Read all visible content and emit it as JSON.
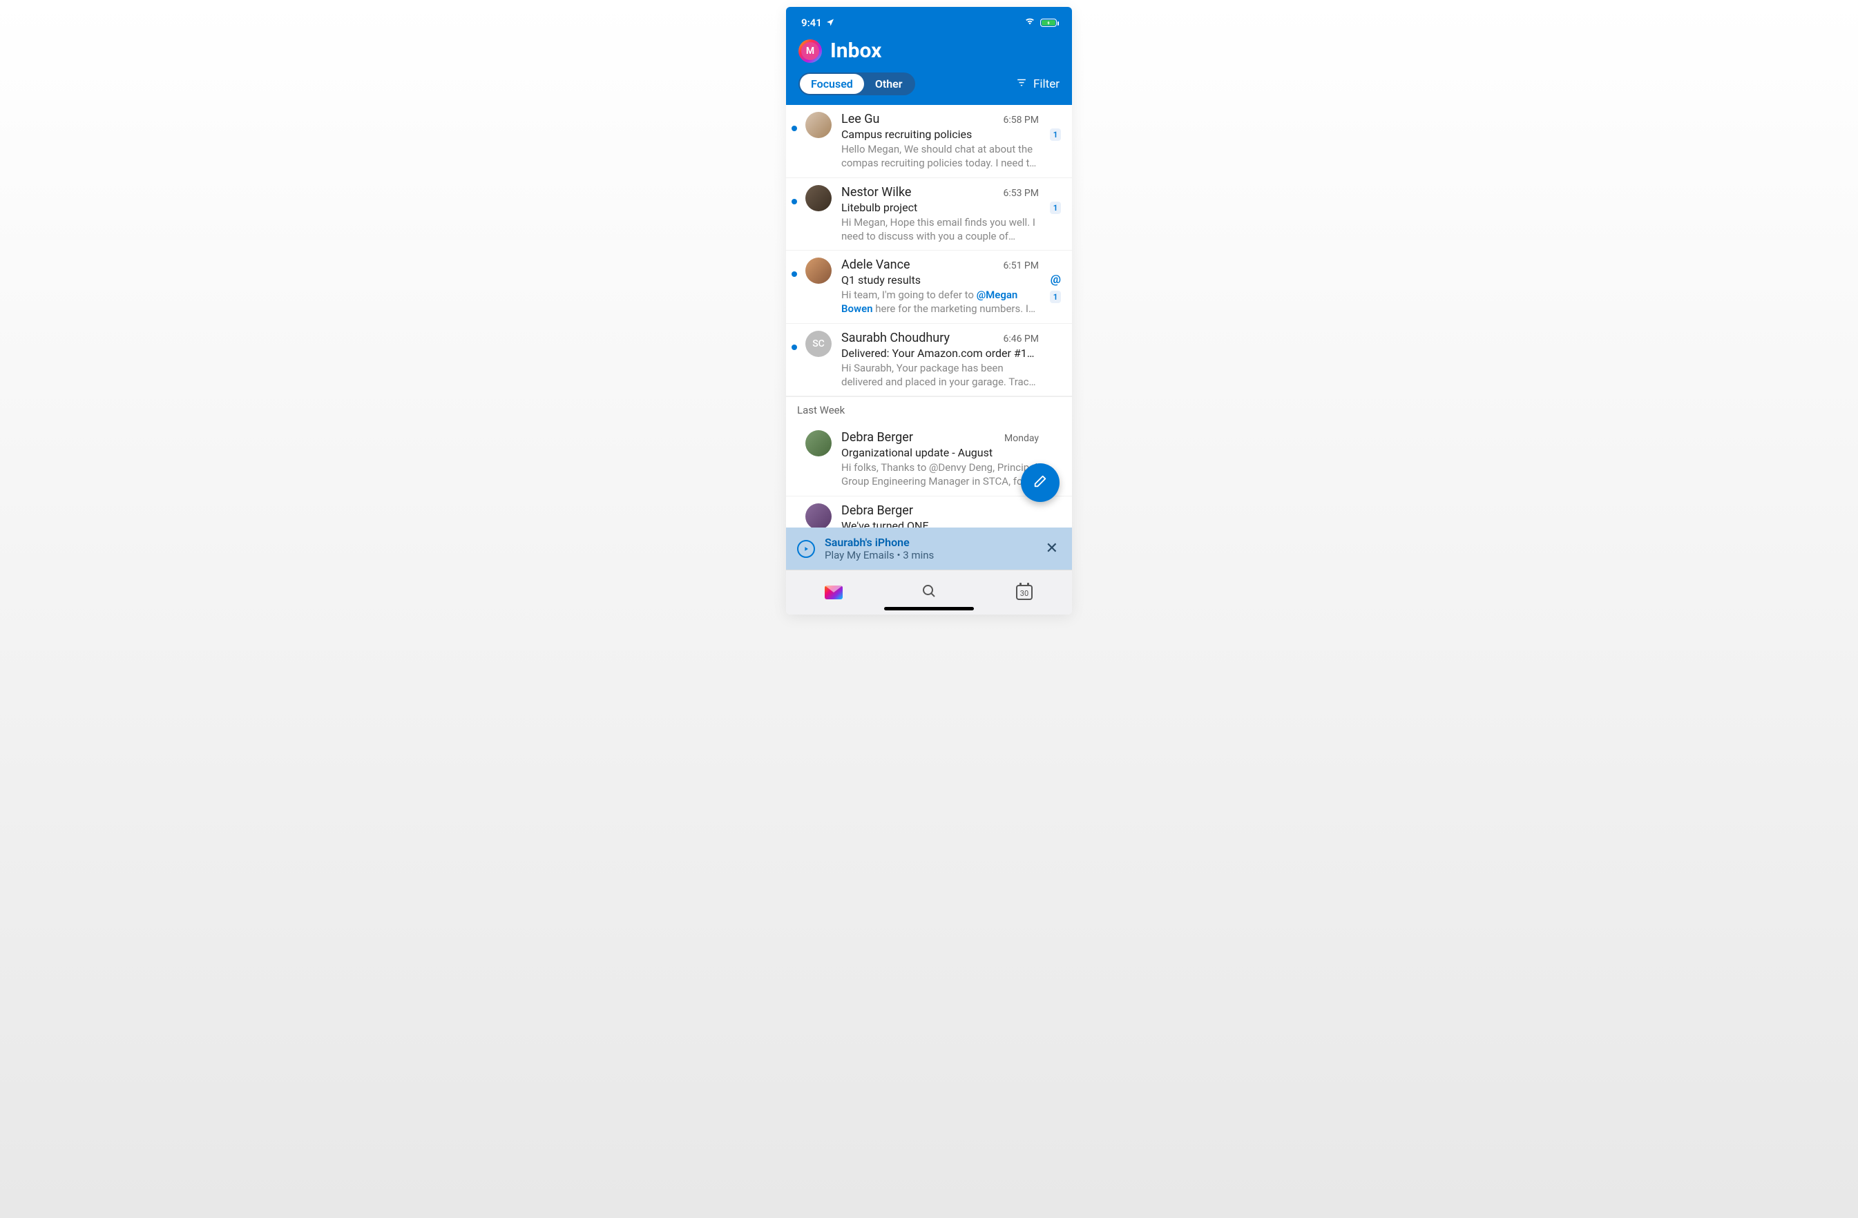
{
  "status": {
    "time": "9:41",
    "battery_pct": 100
  },
  "header": {
    "avatar_initial": "M",
    "title": "Inbox",
    "tab_focused": "Focused",
    "tab_other": "Other",
    "filter_label": "Filter"
  },
  "section_last_week": "Last Week",
  "emails": [
    {
      "sender": "Lee Gu",
      "time": "6:58 PM",
      "subject": "Campus recruiting policies",
      "preview": "Hello Megan, We should chat at about the compas recruiting policies today. I need to c…",
      "unread": true,
      "badge": "1",
      "avatar": "photo1"
    },
    {
      "sender": "Nestor Wilke",
      "time": "6:53 PM",
      "subject": "Litebulb project",
      "preview": "Hi Megan, Hope this email finds you well. I need to discuss with you a couple of things…",
      "unread": true,
      "badge": "1",
      "avatar": "photo2"
    },
    {
      "sender": "Adele Vance",
      "time": "6:51 PM",
      "subject": "Q1 study results",
      "preview_pre": "Hi team, I'm going to defer to ",
      "mention": "@Megan Bowen",
      "preview_post": " here for the marketing numbers. I be…",
      "unread": true,
      "badge": "1",
      "mention_icon": true,
      "avatar": "photo3"
    },
    {
      "sender": "Saurabh Choudhury",
      "time": "6:46 PM",
      "subject": "Delivered: Your Amazon.com order #112-5051…",
      "preview": "Hi Saurabh, Your package has been delivered and placed in your garage. Track your package…",
      "unread": true,
      "avatar_initials": "SC"
    }
  ],
  "emails_lastweek": [
    {
      "sender": "Debra Berger",
      "time": "Monday",
      "subject": "Organizational update - August",
      "preview": "Hi folks, Thanks to @Denvy Deng, Principal Group Engineering Manager in STCA, for shari…",
      "avatar": "photo5"
    },
    {
      "sender": "Debra Berger",
      "time": "",
      "subject": "We've turned ONE",
      "preview": "",
      "avatar": "photo6"
    }
  ],
  "banner": {
    "title": "Saurabh's iPhone",
    "subtitle": "Play My Emails • 3 mins"
  },
  "calendar_day": "30"
}
